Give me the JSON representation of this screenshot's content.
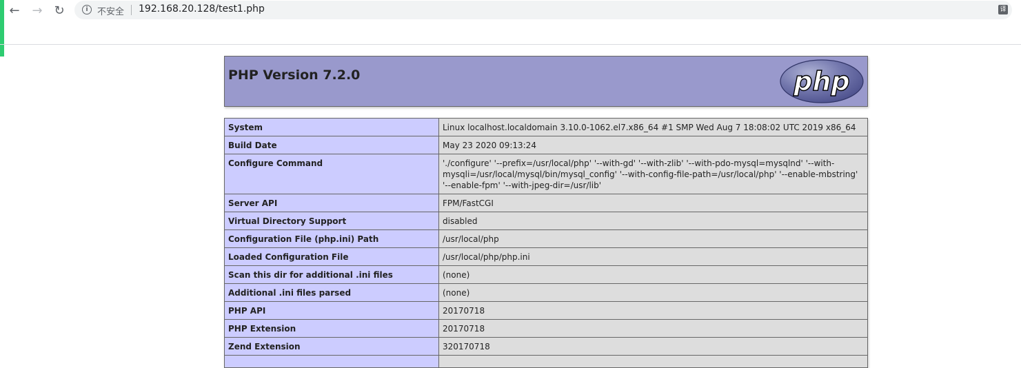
{
  "browser": {
    "back_glyph": "←",
    "forward_glyph": "→",
    "reload_glyph": "↻",
    "info_glyph": "i",
    "insecure_label": "不安全",
    "url": "192.168.20.128/test1.php",
    "translate_glyph": "译"
  },
  "header": {
    "title": "PHP Version 7.2.0",
    "logo_text": "php"
  },
  "rows": [
    {
      "key": "System",
      "value": "Linux localhost.localdomain 3.10.0-1062.el7.x86_64 #1 SMP Wed Aug 7 18:08:02 UTC 2019 x86_64"
    },
    {
      "key": "Build Date",
      "value": "May 23 2020 09:13:24"
    },
    {
      "key": "Configure Command",
      "value": "'./configure' '--prefix=/usr/local/php' '--with-gd' '--with-zlib' '--with-pdo-mysql=mysqlnd' '--with-mysqli=/usr/local/mysql/bin/mysql_config' '--with-config-file-path=/usr/local/php' '--enable-mbstring' '--enable-fpm' '--with-jpeg-dir=/usr/lib'"
    },
    {
      "key": "Server API",
      "value": "FPM/FastCGI"
    },
    {
      "key": "Virtual Directory Support",
      "value": "disabled"
    },
    {
      "key": "Configuration File (php.ini) Path",
      "value": "/usr/local/php"
    },
    {
      "key": "Loaded Configuration File",
      "value": "/usr/local/php/php.ini"
    },
    {
      "key": "Scan this dir for additional .ini files",
      "value": "(none)"
    },
    {
      "key": "Additional .ini files parsed",
      "value": "(none)"
    },
    {
      "key": "PHP API",
      "value": "20170718"
    },
    {
      "key": "PHP Extension",
      "value": "20170718"
    },
    {
      "key": "Zend Extension",
      "value": "320170718"
    },
    {
      "key": "",
      "value": ""
    }
  ]
}
